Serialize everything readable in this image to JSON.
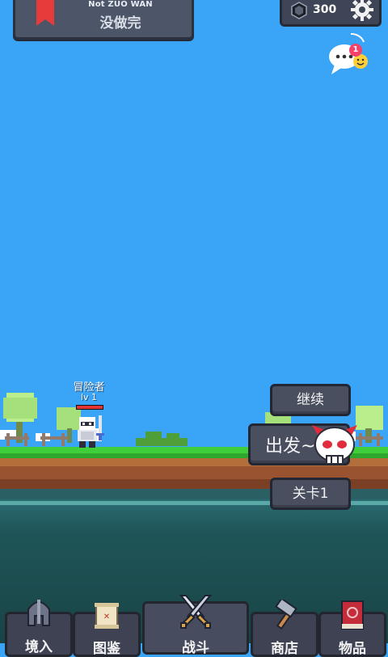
{
  "banner": {
    "subtitle": "Not ZUO WAN",
    "title": "没做完"
  },
  "header": {
    "gems": "300"
  },
  "chat": {
    "badge": "1"
  },
  "hero": {
    "name": "冒险者",
    "level": "lv 1",
    "hp_fraction": 1.0
  },
  "actions": {
    "continue_label": "继续",
    "go_label": "出发~",
    "stage_label": "关卡1"
  },
  "tabs": [
    {
      "label": "境入",
      "icon": "helmet-icon"
    },
    {
      "label": "图鉴",
      "icon": "scroll-icon"
    },
    {
      "label": "战斗",
      "icon": "crossed-swords-icon"
    },
    {
      "label": "商店",
      "icon": "hammer-icon"
    },
    {
      "label": "物品",
      "icon": "red-book-icon"
    }
  ],
  "colors": {
    "sky": "#3aa4f6",
    "panel": "#4a4f60",
    "bookmark": "#e53b3b",
    "badge": "#f4406a"
  }
}
